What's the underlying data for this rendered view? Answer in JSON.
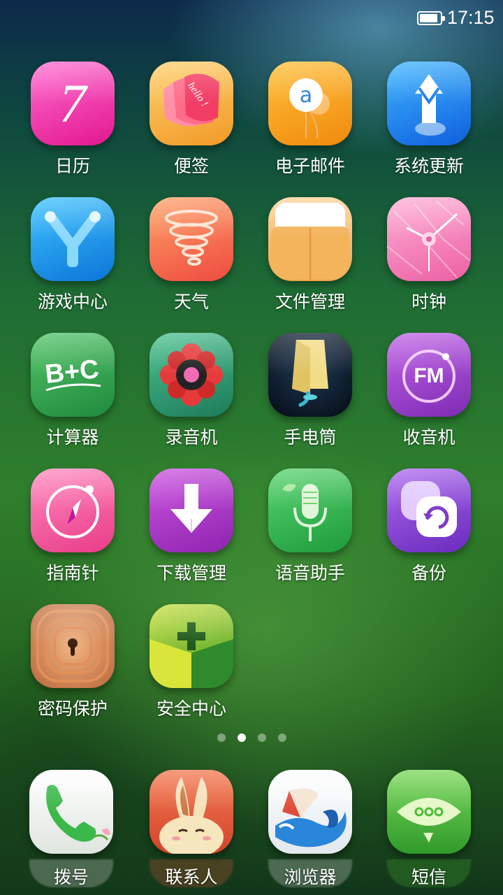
{
  "status_bar": {
    "time": "17:15",
    "battery_level": 0.9,
    "battery_icon": "battery-icon"
  },
  "apps": [
    {
      "label": "日历",
      "icon": "calendar-icon",
      "badge_text": "7",
      "color": "#f23fb1"
    },
    {
      "label": "便签",
      "icon": "notes-icon",
      "badge_text": "hello !",
      "color": "#f7a53a"
    },
    {
      "label": "电子邮件",
      "icon": "email-icon",
      "badge_text": "a",
      "color": "#f59a1a"
    },
    {
      "label": "系统更新",
      "icon": "system-update-icon",
      "color": "#1e7ff0"
    },
    {
      "label": "游戏中心",
      "icon": "game-center-icon",
      "color": "#1596e8"
    },
    {
      "label": "天气",
      "icon": "weather-icon",
      "color": "#f56a4a"
    },
    {
      "label": "文件管理",
      "icon": "file-manager-icon",
      "color": "#f5a84a"
    },
    {
      "label": "时钟",
      "icon": "clock-icon",
      "color": "#f47fb6"
    },
    {
      "label": "计算器",
      "icon": "calculator-icon",
      "badge_text": "B+C",
      "color": "#2fa84f"
    },
    {
      "label": "录音机",
      "icon": "recorder-icon",
      "color": "#2a9c6e"
    },
    {
      "label": "手电筒",
      "icon": "flashlight-icon",
      "color": "#0f2235"
    },
    {
      "label": "收音机",
      "icon": "radio-icon",
      "badge_text": "FM",
      "color": "#9a3fc8"
    },
    {
      "label": "指南针",
      "icon": "compass-icon",
      "color": "#f2509a"
    },
    {
      "label": "下载管理",
      "icon": "download-manager-icon",
      "color": "#a73fc4"
    },
    {
      "label": "语音助手",
      "icon": "voice-assistant-icon",
      "color": "#2cb34e"
    },
    {
      "label": "备份",
      "icon": "backup-icon",
      "color": "#8a42cf"
    },
    {
      "label": "密码保护",
      "icon": "password-protect-icon",
      "color": "#c87a45"
    },
    {
      "label": "安全中心",
      "icon": "security-center-icon",
      "color": "#5cb52a"
    }
  ],
  "pager": {
    "pages": 4,
    "active": 2
  },
  "dock": [
    {
      "label": "拨号",
      "icon": "phone-icon",
      "color": "#f2f4f2"
    },
    {
      "label": "联系人",
      "icon": "contacts-icon",
      "color": "#e85a3a"
    },
    {
      "label": "浏览器",
      "icon": "browser-icon",
      "color": "#f4f6f8"
    },
    {
      "label": "短信",
      "icon": "messages-icon",
      "color": "#4cbc3a"
    }
  ]
}
